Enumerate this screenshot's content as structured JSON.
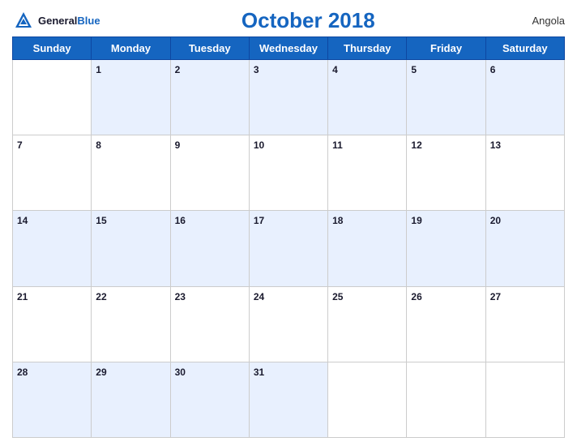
{
  "header": {
    "logo_general": "General",
    "logo_blue": "Blue",
    "title": "October 2018",
    "country": "Angola"
  },
  "days_of_week": [
    "Sunday",
    "Monday",
    "Tuesday",
    "Wednesday",
    "Thursday",
    "Friday",
    "Saturday"
  ],
  "weeks": [
    [
      null,
      1,
      2,
      3,
      4,
      5,
      6
    ],
    [
      7,
      8,
      9,
      10,
      11,
      12,
      13
    ],
    [
      14,
      15,
      16,
      17,
      18,
      19,
      20
    ],
    [
      21,
      22,
      23,
      24,
      25,
      26,
      27
    ],
    [
      28,
      29,
      30,
      31,
      null,
      null,
      null
    ]
  ]
}
